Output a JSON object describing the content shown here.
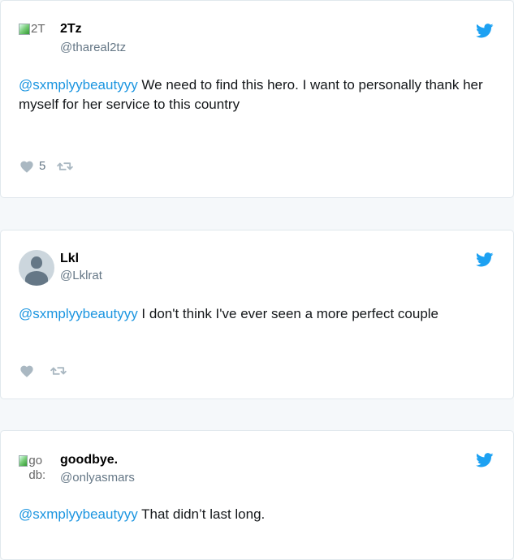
{
  "colors": {
    "background": "#f5f8fa",
    "card": "#ffffff",
    "link": "#1b95e0",
    "muted": "#657786",
    "twitter_blue": "#1da1f2"
  },
  "tweets": [
    {
      "avatar_alt": "2T",
      "name": "2Tz",
      "handle": "@thareal2tz",
      "mention": "@sxmplyybeautyyy",
      "text": " We need to find this hero. I want to personally thank her myself for her service to this country",
      "likes": "5"
    },
    {
      "name": "Lkl",
      "handle": "@Lklrat",
      "mention": "@sxmplyybeautyyy",
      "text": " I don't think I've ever seen a more perfect couple",
      "likes": ""
    },
    {
      "avatar_alt": "go db:",
      "name": "goodbye.",
      "handle": "@onlyasmars",
      "mention": "@sxmplyybeautyyy",
      "text": " That didn’t last long.",
      "likes": ""
    }
  ]
}
